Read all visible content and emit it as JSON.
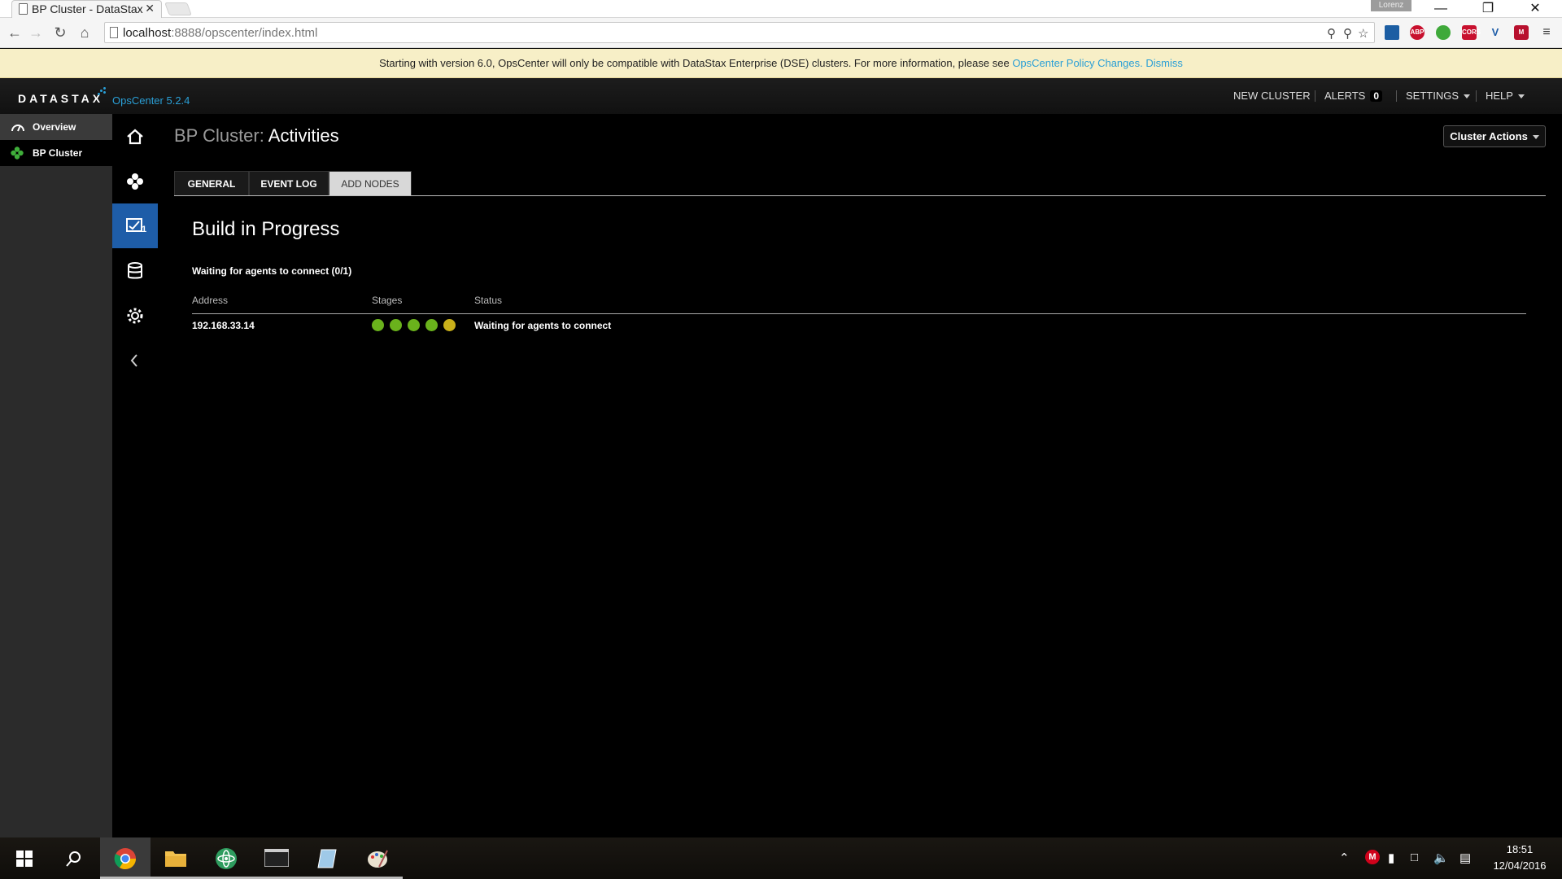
{
  "browser": {
    "tab_title": "BP Cluster - DataStax",
    "tab_close": "✕",
    "profile_name": "Lorenz",
    "url_host": "localhost",
    "url_rest": ":8888/opscenter/index.html",
    "window_buttons": [
      "—",
      "❐",
      "✕"
    ]
  },
  "notice": {
    "text": "Starting with version 6.0, OpsCenter will only be compatible with DataStax Enterprise (DSE) clusters. For more information, please see ",
    "link_label": "OpsCenter Policy Changes.",
    "dismiss_label": "Dismiss"
  },
  "header": {
    "logo": "DATASTAX",
    "version": "OpsCenter 5.2.4",
    "new_cluster": "NEW CLUSTER",
    "alerts": "ALERTS",
    "alerts_count": "0",
    "settings": "SETTINGS",
    "help": "HELP"
  },
  "sidebar": {
    "items": [
      {
        "label": "Overview"
      },
      {
        "label": "BP Cluster"
      }
    ]
  },
  "rail": {
    "activity_count": "1"
  },
  "main": {
    "cluster_name": "BP Cluster:",
    "page_name": "Activities",
    "cluster_actions": "Cluster Actions",
    "tabs": [
      {
        "label": "GENERAL"
      },
      {
        "label": "EVENT LOG"
      },
      {
        "label": "ADD NODES"
      }
    ],
    "build_title": "Build in Progress",
    "waiting_text": "Waiting for agents to connect (0/1)",
    "columns": [
      "Address",
      "Stages",
      "Status"
    ],
    "rows": [
      {
        "address": "192.168.33.14",
        "stages": [
          "complete",
          "complete",
          "complete",
          "complete",
          "in-progress"
        ],
        "status": "Waiting for agents to connect"
      }
    ]
  },
  "colors": {
    "accent": "#2a9fd6",
    "stage_complete": "#6ab21c",
    "stage_in_progress": "#c9b01a",
    "rail_active": "#1e5da8"
  },
  "taskbar": {
    "time": "18:51",
    "date": "12/04/2016"
  }
}
